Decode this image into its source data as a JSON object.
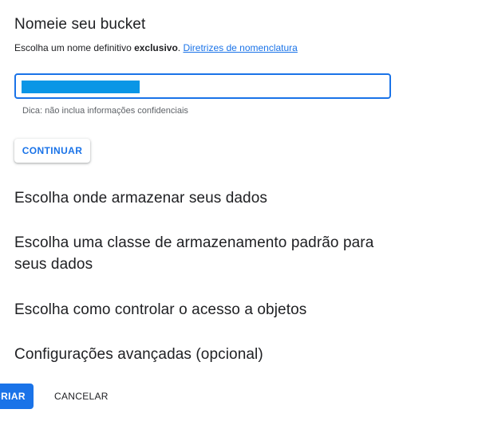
{
  "section_name": {
    "title": "Nomeie seu bucket",
    "subtext_prefix": "Escolha um nome definitivo ",
    "subtext_bold": "exclusivo",
    "subtext_suffix": ". ",
    "naming_link": "Diretrizes de nomenclatura",
    "input_value": "",
    "hint": "Dica: não inclua informações confidenciais",
    "continue_label": "CONTINUAR"
  },
  "sections": [
    {
      "title": "Escolha onde armazenar seus dados"
    },
    {
      "title": "Escolha uma classe de armazenamento padrão para seus dados"
    },
    {
      "title": "Escolha como controlar o acesso a objetos"
    },
    {
      "title": "Configurações avançadas (opcional)"
    }
  ],
  "footer": {
    "create_label": "CRIAR",
    "cancel_label": "CANCELAR"
  },
  "colors": {
    "accent": "#1a73e8",
    "selection": "#0a96e6",
    "text": "#202124",
    "hint": "#5f6368"
  }
}
